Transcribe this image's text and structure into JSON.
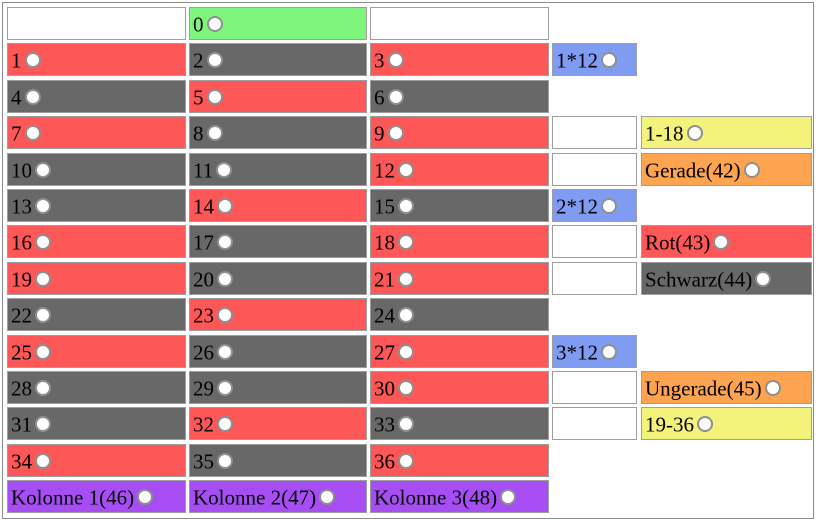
{
  "colors": {
    "red": "#fe5757",
    "black": "#686868",
    "green": "#80f57d",
    "blue": "#7f9bf2",
    "yellow": "#f3f37b",
    "orange": "#fea34f",
    "purple": "#a64ef3"
  },
  "zero": {
    "label": "0",
    "color": "green"
  },
  "numbers": [
    {
      "label": "1",
      "color": "red"
    },
    {
      "label": "2",
      "color": "black"
    },
    {
      "label": "3",
      "color": "red"
    },
    {
      "label": "4",
      "color": "black"
    },
    {
      "label": "5",
      "color": "red"
    },
    {
      "label": "6",
      "color": "black"
    },
    {
      "label": "7",
      "color": "red"
    },
    {
      "label": "8",
      "color": "black"
    },
    {
      "label": "9",
      "color": "red"
    },
    {
      "label": "10",
      "color": "black"
    },
    {
      "label": "11",
      "color": "black"
    },
    {
      "label": "12",
      "color": "red"
    },
    {
      "label": "13",
      "color": "black"
    },
    {
      "label": "14",
      "color": "red"
    },
    {
      "label": "15",
      "color": "black"
    },
    {
      "label": "16",
      "color": "red"
    },
    {
      "label": "17",
      "color": "black"
    },
    {
      "label": "18",
      "color": "red"
    },
    {
      "label": "19",
      "color": "red"
    },
    {
      "label": "20",
      "color": "black"
    },
    {
      "label": "21",
      "color": "red"
    },
    {
      "label": "22",
      "color": "black"
    },
    {
      "label": "23",
      "color": "red"
    },
    {
      "label": "24",
      "color": "black"
    },
    {
      "label": "25",
      "color": "red"
    },
    {
      "label": "26",
      "color": "black"
    },
    {
      "label": "27",
      "color": "red"
    },
    {
      "label": "28",
      "color": "black"
    },
    {
      "label": "29",
      "color": "black"
    },
    {
      "label": "30",
      "color": "red"
    },
    {
      "label": "31",
      "color": "black"
    },
    {
      "label": "32",
      "color": "red"
    },
    {
      "label": "33",
      "color": "black"
    },
    {
      "label": "34",
      "color": "red"
    },
    {
      "label": "35",
      "color": "black"
    },
    {
      "label": "36",
      "color": "red"
    }
  ],
  "dozens": [
    {
      "label": "1*12",
      "color": "blue"
    },
    {
      "label": "2*12",
      "color": "blue"
    },
    {
      "label": "3*12",
      "color": "blue"
    }
  ],
  "outside_bets": [
    {
      "label": "1-18",
      "color": "yellow"
    },
    {
      "label": "Gerade(42)",
      "color": "orange"
    },
    {
      "label": "Rot(43)",
      "color": "red"
    },
    {
      "label": "Schwarz(44)",
      "color": "black"
    },
    {
      "label": "Ungerade(45)",
      "color": "orange"
    },
    {
      "label": "19-36",
      "color": "yellow"
    }
  ],
  "columns": [
    {
      "label": "Kolonne 1(46)",
      "color": "purple"
    },
    {
      "label": "Kolonne 2(47)",
      "color": "purple"
    },
    {
      "label": "Kolonne 3(48)",
      "color": "purple"
    }
  ]
}
